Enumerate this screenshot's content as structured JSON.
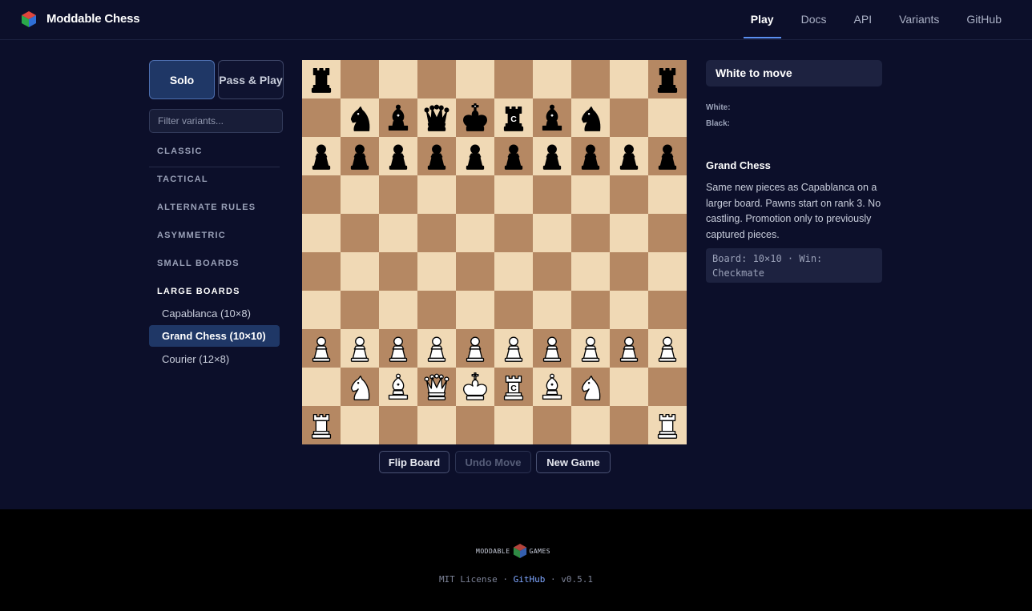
{
  "header": {
    "brand": "Moddable Chess",
    "nav": [
      "Play",
      "Docs",
      "API",
      "Variants",
      "GitHub"
    ],
    "active_nav": "Play",
    "accent": "#5a8ff0"
  },
  "sidebar": {
    "modes": [
      "Solo",
      "Pass & Play"
    ],
    "active_mode": "Solo",
    "filter_placeholder": "Filter variants...",
    "categories": [
      "CLASSIC",
      "TACTICAL",
      "ALTERNATE RULES",
      "ASYMMETRIC",
      "SMALL BOARDS",
      "LARGE BOARDS"
    ],
    "open_category": "LARGE BOARDS",
    "variants": [
      "Capablanca (10×8)",
      "Grand Chess (10×10)",
      "Courier (12×8)"
    ],
    "active_variant": "Grand Chess (10×10)"
  },
  "board": {
    "size": "10x10",
    "light_color": "#f0d9b5",
    "dark_color": "#b58863",
    "rows": [
      [
        "bR",
        "",
        "",
        "",
        "",
        "",
        "",
        "",
        "",
        "bR"
      ],
      [
        "",
        "bN",
        "bB",
        "bQ",
        "bK",
        "bC",
        "bB",
        "bN",
        "",
        ""
      ],
      [
        "bP",
        "bP",
        "bP",
        "bP",
        "bP",
        "bP",
        "bP",
        "bP",
        "bP",
        "bP"
      ],
      [
        "",
        "",
        "",
        "",
        "",
        "",
        "",
        "",
        "",
        ""
      ],
      [
        "",
        "",
        "",
        "",
        "",
        "",
        "",
        "",
        "",
        ""
      ],
      [
        "",
        "",
        "",
        "",
        "",
        "",
        "",
        "",
        "",
        ""
      ],
      [
        "",
        "",
        "",
        "",
        "",
        "",
        "",
        "",
        "",
        ""
      ],
      [
        "wP",
        "wP",
        "wP",
        "wP",
        "wP",
        "wP",
        "wP",
        "wP",
        "wP",
        "wP"
      ],
      [
        "",
        "wN",
        "wB",
        "wQ",
        "wK",
        "wC",
        "wB",
        "wN",
        "",
        ""
      ],
      [
        "wR",
        "",
        "",
        "",
        "",
        "",
        "",
        "",
        "",
        "wR"
      ]
    ]
  },
  "controls": {
    "flip": "Flip Board",
    "undo": "Undo Move",
    "new_game": "New Game"
  },
  "panel": {
    "status": "White to move",
    "white_label": "White:",
    "black_label": "Black:",
    "variant_title": "Grand Chess",
    "variant_desc": "Same new pieces as Capablanca on a larger board. Pawns start on rank 3. No castling. Promotion only to previously captured pieces.",
    "variant_meta": "Board: 10×10 · Win: Checkmate"
  },
  "footer": {
    "logo_left": "MODDABLE",
    "logo_right": "GAMES",
    "license": "MIT License",
    "sep": "·",
    "github": "GitHub",
    "version": "v0.5.1"
  }
}
